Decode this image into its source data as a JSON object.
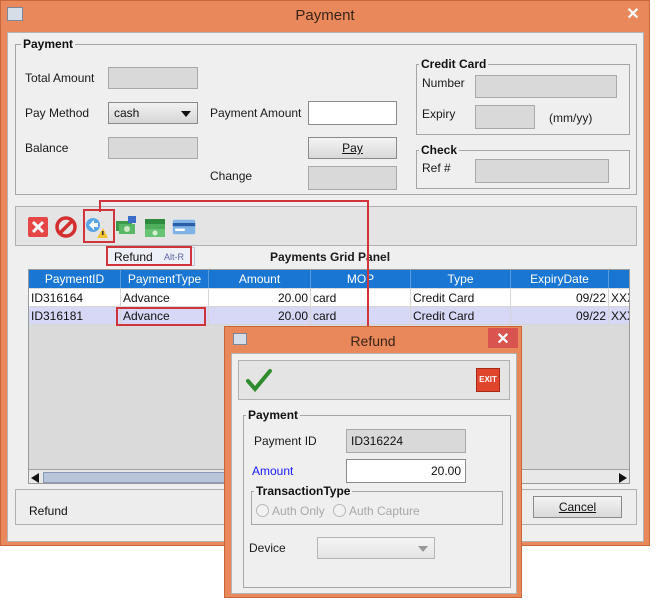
{
  "window": {
    "title": "Payment",
    "close_label": "✕"
  },
  "payment": {
    "legend": "Payment",
    "total_amount_label": "Total Amount",
    "total_amount_value": "",
    "pay_method_label": "Pay Method",
    "pay_method_value": "cash",
    "payment_amount_label": "Payment Amount",
    "payment_amount_value": "",
    "balance_label": "Balance",
    "balance_value": "",
    "pay_button": "Pay",
    "change_label": "Change",
    "change_value": ""
  },
  "credit_card": {
    "legend": "Credit Card",
    "number_label": "Number",
    "number_value": "",
    "expiry_label": "Expiry",
    "expiry_value": "",
    "expiry_hint": "(mm/yy)"
  },
  "check": {
    "legend": "Check",
    "ref_label": "Ref #",
    "ref_value": ""
  },
  "toolbar": {
    "refund_tooltip": "Refund",
    "refund_shortcut": "Alt-R",
    "icons": [
      "delete-icon",
      "cancel-icon",
      "refund-icon",
      "cash-icon",
      "money-icon",
      "card-icon"
    ]
  },
  "grid": {
    "title": "Payments Grid Panel",
    "columns": [
      "PaymentID",
      "PaymentType",
      "Amount",
      "MOP",
      "Type",
      "ExpiryDate",
      ""
    ],
    "rows": [
      [
        "ID316164",
        "Advance",
        "20.00",
        "card",
        "Credit Card",
        "09/22",
        "XXX"
      ],
      [
        "ID316181",
        "Advance",
        "20.00",
        "card",
        "Credit Card",
        "09/22",
        "XXX"
      ]
    ],
    "selected_row": 1
  },
  "status": {
    "text": "Refund",
    "cancel_button": "Cancel"
  },
  "refund_dialog": {
    "title": "Refund",
    "close_label": "✕",
    "exit_label": "EXIT",
    "payment_legend": "Payment",
    "payment_id_label": "Payment ID",
    "payment_id_value": "ID316224",
    "amount_label": "Amount",
    "amount_value": "20.00",
    "transaction_type_legend": "TransactionType",
    "auth_only_label": "Auth Only",
    "auth_capture_label": "Auth Capture",
    "device_label": "Device",
    "device_value": ""
  },
  "colors": {
    "window_frame": "#e9885a",
    "grid_header": "#1976d2",
    "selected_row": "#d6d8f5",
    "annotation": "#d0343a",
    "amount_label": "#1a1aff"
  }
}
